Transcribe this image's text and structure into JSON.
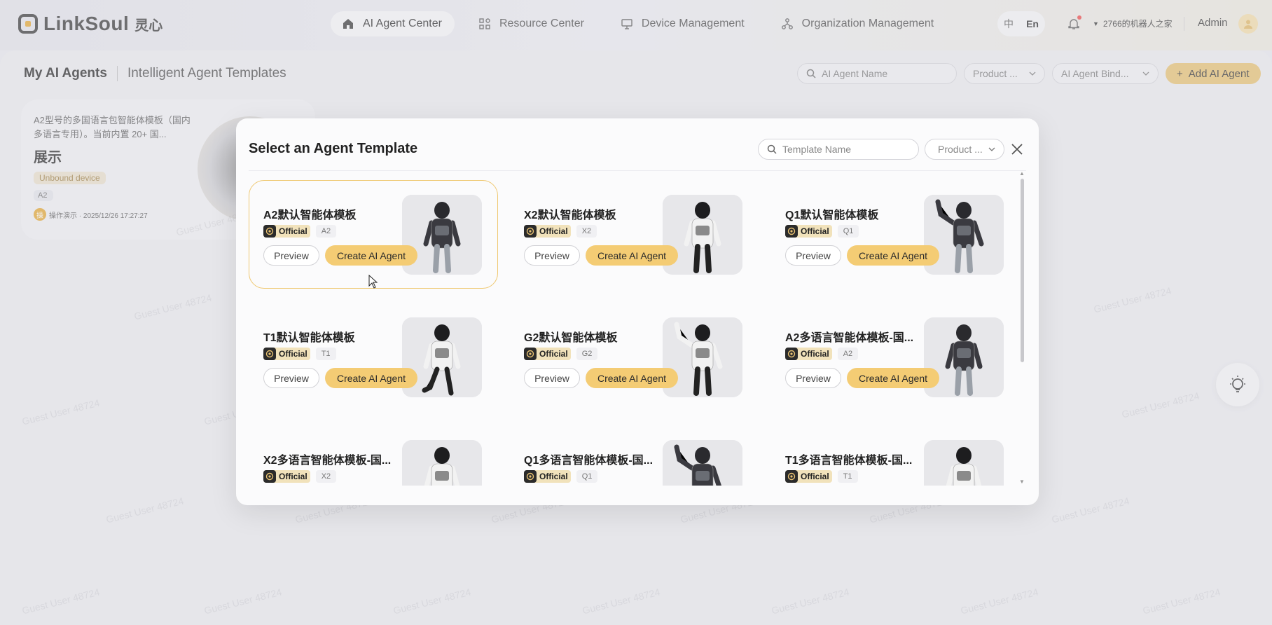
{
  "brand": {
    "name": "LinkSoul",
    "cn": "灵心"
  },
  "nav": [
    {
      "label": "AI Agent Center",
      "icon": "home-icon",
      "active": true
    },
    {
      "label": "Resource Center",
      "icon": "grid-icon",
      "active": false
    },
    {
      "label": "Device Management",
      "icon": "monitor-icon",
      "active": false
    },
    {
      "label": "Organization Management",
      "icon": "org-icon",
      "active": false
    }
  ],
  "lang": {
    "cn": "中",
    "en": "En"
  },
  "org_name": "2766的机器人之家",
  "user": "Admin",
  "page": {
    "tab_main": "My AI Agents",
    "tab_sub": "Intelligent Agent Templates",
    "search_placeholder": "AI Agent Name",
    "filter_product": "Product ...",
    "filter_bind": "AI Agent Bind...",
    "add_label": "Add AI Agent"
  },
  "agent_card": {
    "desc": "A2型号的多国语言包智能体模板（国内多语言专用）。当前内置 20+ 国...",
    "title": "展示",
    "status": "Unbound device",
    "model": "A2",
    "meta_icon": "操",
    "meta": "操作演示 · 2025/12/26 17:27:27"
  },
  "watermark": "Guest User 48724",
  "modal": {
    "title": "Select an Agent Template",
    "search_placeholder": "Template Name",
    "product_filter": "Product ...",
    "official_label": "Official",
    "preview_label": "Preview",
    "create_label": "Create AI Agent",
    "templates": [
      {
        "name": "A2默认智能体模板",
        "model": "A2",
        "robot": "humanoid-dark"
      },
      {
        "name": "X2默认智能体模板",
        "model": "X2",
        "robot": "humanoid-white"
      },
      {
        "name": "Q1默认智能体模板",
        "model": "Q1",
        "robot": "humanoid-wave"
      },
      {
        "name": "T1默认智能体模板",
        "model": "T1",
        "robot": "humanoid-kick"
      },
      {
        "name": "G2默认智能体模板",
        "model": "G2",
        "robot": "humanoid-wave-white"
      },
      {
        "name": "A2多语言智能体模板-国...",
        "model": "A2",
        "robot": "humanoid-dark"
      },
      {
        "name": "X2多语言智能体模板-国...",
        "model": "X2",
        "robot": "humanoid-white"
      },
      {
        "name": "Q1多语言智能体模板-国...",
        "model": "Q1",
        "robot": "humanoid-wave"
      },
      {
        "name": "T1多语言智能体模板-国...",
        "model": "T1",
        "robot": "humanoid-kick"
      }
    ]
  }
}
